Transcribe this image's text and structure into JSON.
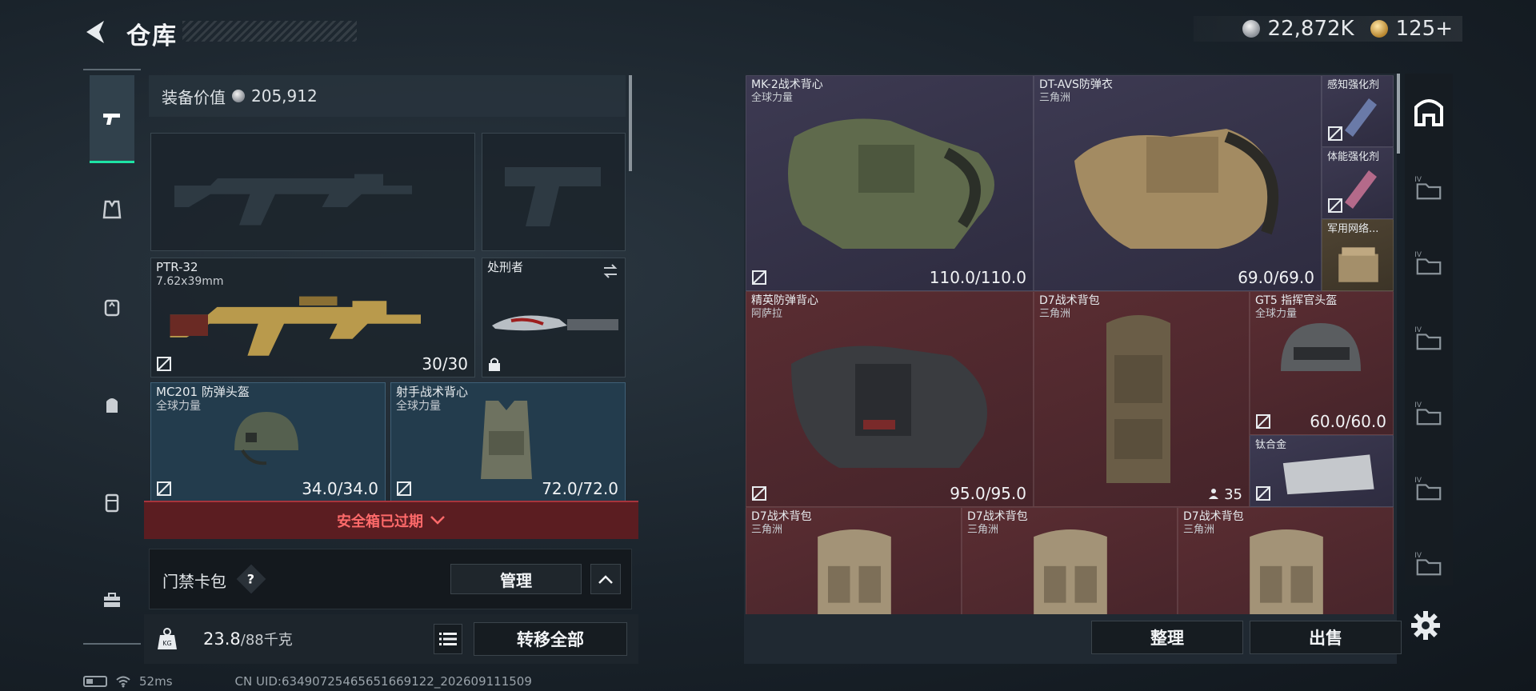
{
  "header": {
    "title": "仓库",
    "currency_silver": "22,872K",
    "currency_gold": "125+"
  },
  "equipment": {
    "value_label": "装备价值",
    "value": "205,912",
    "primary_weapon": {
      "name": "PTR-32",
      "ammo": "7.62x39mm",
      "durability": "30/30"
    },
    "melee": {
      "name": "处刑者"
    },
    "helmet": {
      "name": "MC201 防弹头盔",
      "map": "全球力量",
      "durability": "34.0/34.0"
    },
    "armor": {
      "name": "射手战术背心",
      "map": "全球力量",
      "durability": "72.0/72.0"
    },
    "safebox": "安全箱已过期",
    "keycard": {
      "label": "门禁卡包",
      "help": "?",
      "manage": "管理"
    },
    "weight": {
      "current": "23.8",
      "max": "/88千克"
    },
    "transfer_all": "转移全部"
  },
  "status_bar": {
    "ping": "52ms",
    "uid": "CN UID:634907254656516691​22_202609111509"
  },
  "stash": {
    "items": [
      {
        "name": "MK-2战术背心",
        "map": "全球力量",
        "durability": "110.0/110.0"
      },
      {
        "name": "DT-AVS防弹衣",
        "map": "三角洲",
        "durability": "69.0/69.0"
      },
      {
        "name": "感知强化剂"
      },
      {
        "name": "体能强化剂"
      },
      {
        "name": "军用网络..."
      },
      {
        "name": "精英防弹背心",
        "map": "阿萨拉",
        "durability": "95.0/95.0"
      },
      {
        "name": "D7战术背包",
        "map": "三角洲",
        "count": "35"
      },
      {
        "name": "GT5 指挥官头盔",
        "map": "全球力量",
        "durability": "60.0/60.0"
      },
      {
        "name": "钛合金"
      },
      {
        "name": "D7战术背包",
        "map": "三角洲"
      },
      {
        "name": "D7战术背包",
        "map": "三角洲"
      },
      {
        "name": "D7战术背包",
        "map": "三角洲"
      }
    ],
    "sort_label": "整理",
    "sell_label": "出售"
  },
  "right_rail": [
    "base-icon",
    "iv-tab-1",
    "iv-tab-2",
    "iv-tab-3",
    "iv-tab-4",
    "iv-tab-5",
    "iv-tab-6"
  ],
  "colors": {
    "accent": "#1ee3a5",
    "danger": "#ff6a6a",
    "purple_rarity": "#3d3a52",
    "red_rarity": "#5a2d32",
    "gold_rarity": "#4f4433"
  }
}
